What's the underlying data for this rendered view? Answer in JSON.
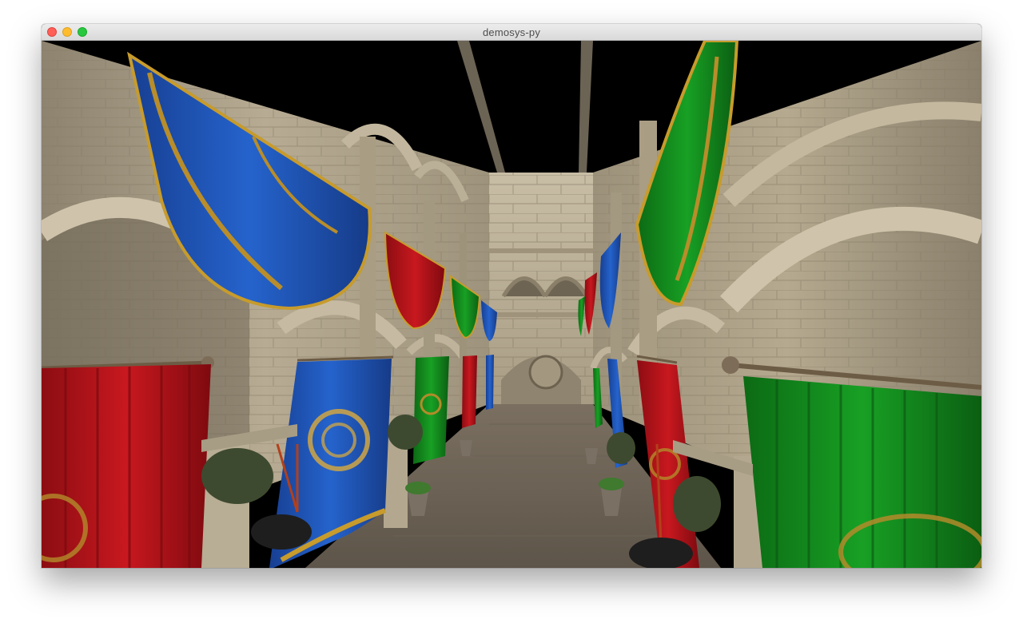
{
  "window": {
    "title": "demosys-py",
    "controls": [
      "close",
      "minimize",
      "zoom"
    ]
  },
  "scene": {
    "description_icon": "render-viewport",
    "colors": {
      "stone": "#b9ac92",
      "sky": "#000000",
      "banner_blue": "#1f55b8",
      "banner_red": "#b3151c",
      "banner_green": "#138a1e",
      "gold": "#c79b2c"
    }
  }
}
